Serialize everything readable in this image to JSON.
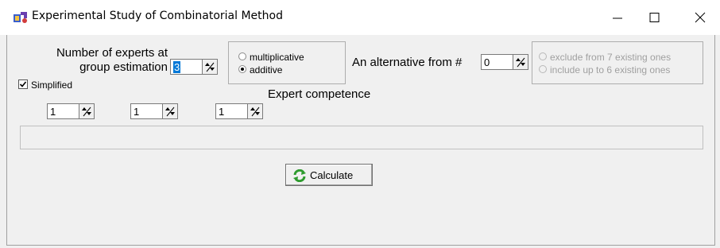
{
  "window": {
    "title": "Experimental Study of Combinatorial Method"
  },
  "experts": {
    "label_line1": "Number of experts at",
    "label_line2": "group estimation",
    "value": "3"
  },
  "mode_group": {
    "options": [
      {
        "label": "multiplicative",
        "selected": false
      },
      {
        "label": "additive",
        "selected": true
      }
    ]
  },
  "alternative": {
    "label": "An alternative from #",
    "value": "0"
  },
  "existing_group": {
    "enabled": false,
    "options": [
      {
        "label": "exclude from 7 existing ones",
        "selected": false
      },
      {
        "label": "include up to 6 existing ones",
        "selected": false
      }
    ]
  },
  "simplified": {
    "label": "Simplified",
    "checked": true
  },
  "competence": {
    "label": "Expert competence",
    "values": [
      "1",
      "1",
      "1"
    ]
  },
  "calculate_button": {
    "label": "Calculate"
  },
  "colors": {
    "selection": "#0078d7",
    "icon_green": "#2e9b2e"
  }
}
